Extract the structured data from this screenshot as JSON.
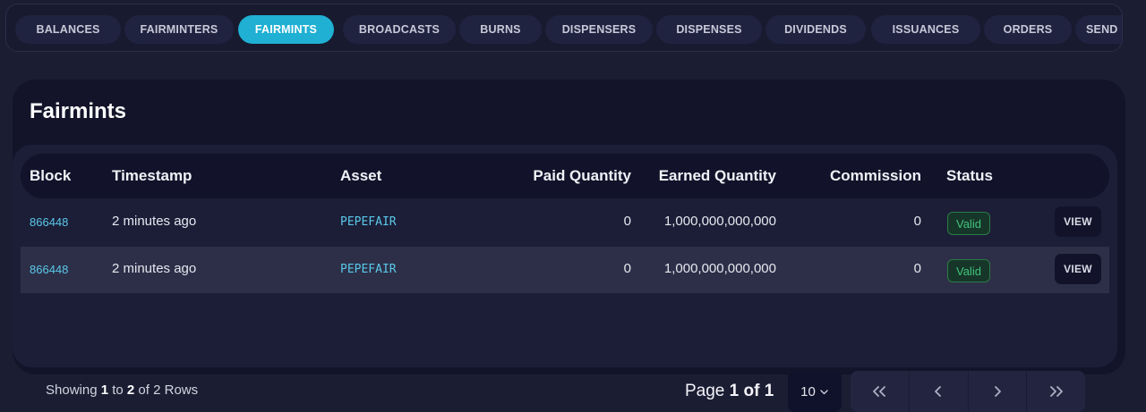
{
  "tabs": [
    {
      "label": "BALANCES",
      "active": false
    },
    {
      "label": "FAIRMINTERS",
      "active": false
    },
    {
      "label": "FAIRMINTS",
      "active": true
    },
    {
      "label": "BROADCASTS",
      "active": false
    },
    {
      "label": "BURNS",
      "active": false
    },
    {
      "label": "DISPENSERS",
      "active": false
    },
    {
      "label": "DISPENSES",
      "active": false
    },
    {
      "label": "DIVIDENDS",
      "active": false
    },
    {
      "label": "ISSUANCES",
      "active": false
    },
    {
      "label": "ORDERS",
      "active": false
    },
    {
      "label": "SEND",
      "active": false
    }
  ],
  "card": {
    "title": "Fairmints"
  },
  "table": {
    "columns": [
      "Block",
      "Timestamp",
      "Asset",
      "Paid Quantity",
      "Earned Quantity",
      "Commission",
      "Status"
    ],
    "rows": [
      {
        "block": "866448",
        "timestamp": "2 minutes ago",
        "asset": "PEPEFAIR",
        "paid": "0",
        "earned": "1,000,000,000,000",
        "commission": "0",
        "status": "Valid",
        "action": "VIEW"
      },
      {
        "block": "866448",
        "timestamp": "2 minutes ago",
        "asset": "PEPEFAIR",
        "paid": "0",
        "earned": "1,000,000,000,000",
        "commission": "0",
        "status": "Valid",
        "action": "VIEW"
      }
    ]
  },
  "footer": {
    "showing_prefix": "Showing ",
    "from": "1",
    "to_word": " to ",
    "to": "2",
    "of_word": " of 2 Rows",
    "page_word": "Page ",
    "page_value": "1 of 1",
    "page_size": "10"
  },
  "pager_icons": [
    "double-chevron-left-icon",
    "chevron-left-icon",
    "chevron-right-icon",
    "double-chevron-right-icon"
  ],
  "colors": {
    "accent": "#1fb0d3",
    "link": "#5ac8e8",
    "valid": "#40c47a"
  }
}
